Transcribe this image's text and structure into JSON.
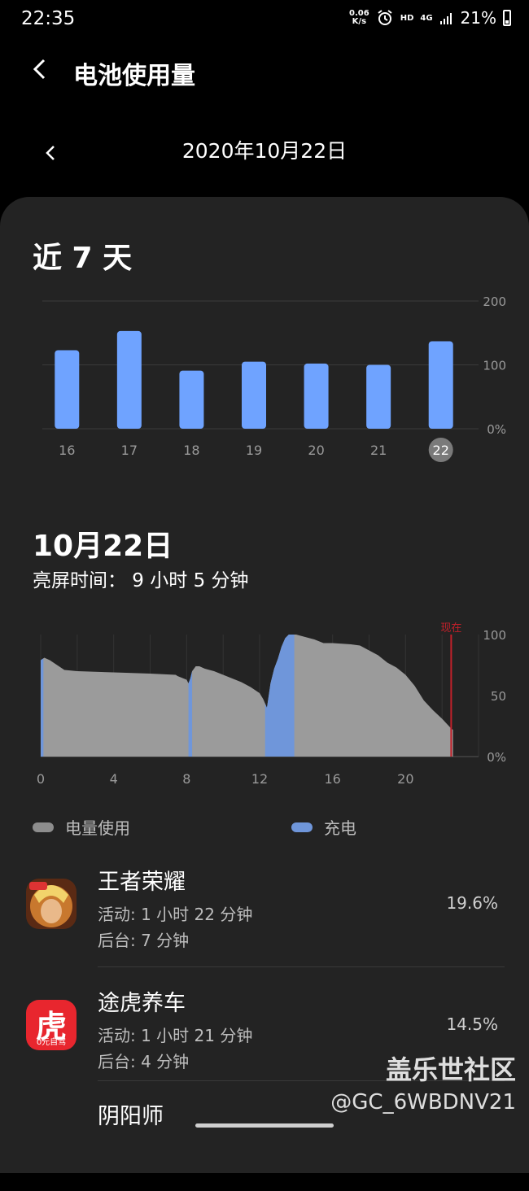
{
  "status_bar": {
    "time": "22:35",
    "speed_top": "0.06",
    "speed_bottom": "K/s",
    "hd": "HD",
    "net": "4G",
    "battery": "21%"
  },
  "header": {
    "title": "电池使用量"
  },
  "date_nav": {
    "date": "2020年10月22日"
  },
  "week": {
    "title": "近 7 天"
  },
  "colors": {
    "bar": "#6fa3ff",
    "usage": "#9b9b9b",
    "charge": "#6f96da",
    "now_line": "#c0202a",
    "selected_day": "#7a7a7a"
  },
  "day": {
    "title": "10月22日",
    "screen_time": "亮屏时间：  9 小时 5 分钟"
  },
  "legend": {
    "usage": "电量使用",
    "charging": "充电"
  },
  "apps": [
    {
      "name": "王者荣耀",
      "active": "活动: 1 小时 22 分钟",
      "background": "后台: 7 分钟",
      "percent": "19.6%",
      "icon": "game-hero-icon"
    },
    {
      "name": "途虎养车",
      "active": "活动: 1 小时 21 分钟",
      "background": "后台: 4 分钟",
      "percent": "14.5%",
      "icon": "tiger-icon",
      "icon_char": "虎",
      "icon_caption": "0元自驾"
    },
    {
      "name": "阴阳师"
    }
  ],
  "watermark": {
    "line1": "盖乐世社区",
    "line2": "@GC_6WBDNV21"
  },
  "chart_data": [
    {
      "type": "bar",
      "title": "近 7 天",
      "categories": [
        "16",
        "17",
        "18",
        "19",
        "20",
        "21",
        "22"
      ],
      "values": [
        123,
        153,
        91,
        105,
        102,
        100,
        137
      ],
      "yticks": [
        "0%",
        "100",
        "200"
      ],
      "ylim": [
        0,
        200
      ],
      "selected": "22",
      "grid": true
    },
    {
      "type": "area",
      "title": "10月22日",
      "x_ticks": [
        "0",
        "4",
        "8",
        "12",
        "16",
        "20"
      ],
      "y_ticks": [
        "0%",
        "50",
        "100"
      ],
      "xlim": [
        0,
        24
      ],
      "ylim": [
        0,
        100
      ],
      "now_label": "现在",
      "now_x": 22.5,
      "series": [
        {
          "name": "电量使用",
          "points": [
            [
              0,
              79
            ],
            [
              0.2,
              81
            ],
            [
              0.5,
              79
            ],
            [
              1,
              74
            ],
            [
              1.3,
              71
            ],
            [
              2,
              70
            ],
            [
              4,
              69
            ],
            [
              6,
              68
            ],
            [
              7.4,
              67
            ],
            [
              7.5,
              66
            ],
            [
              8,
              63
            ],
            [
              8.1,
              60
            ],
            [
              8.2,
              64
            ],
            [
              8.3,
              70
            ],
            [
              8.5,
              74
            ],
            [
              8.7,
              74
            ],
            [
              9,
              72
            ],
            [
              9.5,
              70
            ],
            [
              10,
              67
            ],
            [
              11,
              61
            ],
            [
              11.5,
              57
            ],
            [
              12,
              52
            ],
            [
              12.2,
              47
            ],
            [
              12.4,
              40
            ],
            [
              12.5,
              50
            ],
            [
              12.6,
              60
            ],
            [
              12.8,
              72
            ],
            [
              13,
              80
            ],
            [
              13.2,
              90
            ],
            [
              13.4,
              97
            ],
            [
              13.6,
              100
            ],
            [
              13.9,
              100
            ],
            [
              14,
              100
            ],
            [
              14.5,
              98
            ],
            [
              15,
              96
            ],
            [
              15.5,
              93
            ],
            [
              16,
              93
            ],
            [
              17,
              92
            ],
            [
              17.5,
              91
            ],
            [
              18,
              87
            ],
            [
              18.5,
              83
            ],
            [
              19,
              77
            ],
            [
              19.5,
              73
            ],
            [
              20,
              67
            ],
            [
              20.5,
              58
            ],
            [
              21,
              46
            ],
            [
              21.5,
              38
            ],
            [
              22,
              31
            ],
            [
              22.5,
              23
            ],
            [
              22.6,
              22
            ]
          ]
        },
        {
          "name": "充电",
          "ranges": [
            [
              0,
              0.15
            ],
            [
              8.1,
              8.3
            ],
            [
              12.3,
              13.9
            ]
          ]
        }
      ]
    }
  ]
}
